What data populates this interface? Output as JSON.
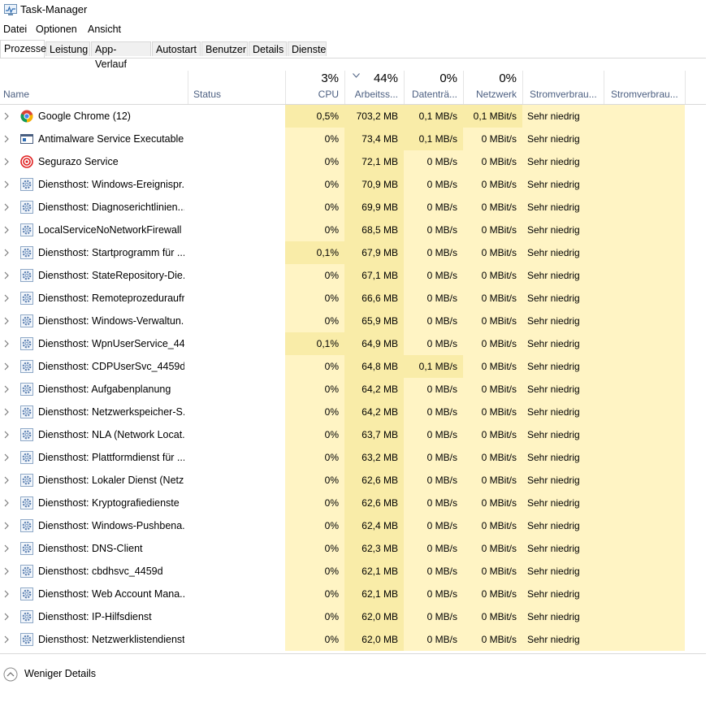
{
  "window": {
    "title": "Task-Manager"
  },
  "menu": [
    "Datei",
    "Optionen",
    "Ansicht"
  ],
  "tabs": [
    "Prozesse",
    "Leistung",
    "App-Verlauf",
    "Autostart",
    "Benutzer",
    "Details",
    "Dienste"
  ],
  "active_tab": "Prozesse",
  "columns": {
    "name": "Name",
    "status": "Status",
    "cpu": {
      "pct": "3%",
      "label": "CPU"
    },
    "mem": {
      "pct": "44%",
      "label": "Arbeitss..."
    },
    "disk": {
      "pct": "0%",
      "label": "Datenträ..."
    },
    "net": {
      "pct": "0%",
      "label": "Netzwerk"
    },
    "power": "Stromverbrau...",
    "power_trend": "Stromverbrau..."
  },
  "colors": {
    "heat_light": "#fff4c4",
    "heat_mid": "#f9eca8",
    "header_label": "#4d6082"
  },
  "processes": [
    {
      "name": "Google Chrome (12)",
      "icon": "chrome-icon",
      "cpu": "0,5%",
      "mem": "703,2 MB",
      "disk": "0,1 MB/s",
      "net": "0,1 MBit/s",
      "power": "Sehr niedrig",
      "cpu_hot": true,
      "disk_hot": true,
      "net_hot": true
    },
    {
      "name": "Antimalware Service Executable",
      "icon": "antimalware-icon",
      "cpu": "0%",
      "mem": "73,4 MB",
      "disk": "0,1 MB/s",
      "net": "0 MBit/s",
      "power": "Sehr niedrig",
      "disk_hot": true
    },
    {
      "name": "Segurazo Service",
      "icon": "segurazo-icon",
      "cpu": "0%",
      "mem": "72,1 MB",
      "disk": "0 MB/s",
      "net": "0 MBit/s",
      "power": "Sehr niedrig"
    },
    {
      "name": "Diensthost: Windows-Ereignispr...",
      "icon": "gear-icon",
      "cpu": "0%",
      "mem": "70,9 MB",
      "disk": "0 MB/s",
      "net": "0 MBit/s",
      "power": "Sehr niedrig"
    },
    {
      "name": "Diensthost: Diagnoserichtlinien...",
      "icon": "gear-icon",
      "cpu": "0%",
      "mem": "69,9 MB",
      "disk": "0 MB/s",
      "net": "0 MBit/s",
      "power": "Sehr niedrig"
    },
    {
      "name": "LocalServiceNoNetworkFirewall ...",
      "icon": "gear-icon",
      "cpu": "0%",
      "mem": "68,5 MB",
      "disk": "0 MB/s",
      "net": "0 MBit/s",
      "power": "Sehr niedrig"
    },
    {
      "name": "Diensthost: Startprogramm für ...",
      "icon": "gear-icon",
      "cpu": "0,1%",
      "mem": "67,9 MB",
      "disk": "0 MB/s",
      "net": "0 MBit/s",
      "power": "Sehr niedrig",
      "cpu_hot": true
    },
    {
      "name": "Diensthost: StateRepository-Die...",
      "icon": "gear-icon",
      "cpu": "0%",
      "mem": "67,1 MB",
      "disk": "0 MB/s",
      "net": "0 MBit/s",
      "power": "Sehr niedrig"
    },
    {
      "name": "Diensthost: Remoteprozeduraufr...",
      "icon": "gear-icon",
      "cpu": "0%",
      "mem": "66,6 MB",
      "disk": "0 MB/s",
      "net": "0 MBit/s",
      "power": "Sehr niedrig"
    },
    {
      "name": "Diensthost: Windows-Verwaltun...",
      "icon": "gear-icon",
      "cpu": "0%",
      "mem": "65,9 MB",
      "disk": "0 MB/s",
      "net": "0 MBit/s",
      "power": "Sehr niedrig"
    },
    {
      "name": "Diensthost: WpnUserService_44...",
      "icon": "gear-icon",
      "cpu": "0,1%",
      "mem": "64,9 MB",
      "disk": "0 MB/s",
      "net": "0 MBit/s",
      "power": "Sehr niedrig",
      "cpu_hot": true
    },
    {
      "name": "Diensthost: CDPUserSvc_4459d",
      "icon": "gear-icon",
      "cpu": "0%",
      "mem": "64,8 MB",
      "disk": "0,1 MB/s",
      "net": "0 MBit/s",
      "power": "Sehr niedrig",
      "disk_hot": true
    },
    {
      "name": "Diensthost: Aufgabenplanung",
      "icon": "gear-icon",
      "cpu": "0%",
      "mem": "64,2 MB",
      "disk": "0 MB/s",
      "net": "0 MBit/s",
      "power": "Sehr niedrig"
    },
    {
      "name": "Diensthost: Netzwerkspeicher-S...",
      "icon": "gear-icon",
      "cpu": "0%",
      "mem": "64,2 MB",
      "disk": "0 MB/s",
      "net": "0 MBit/s",
      "power": "Sehr niedrig"
    },
    {
      "name": "Diensthost: NLA (Network Locat...",
      "icon": "gear-icon",
      "cpu": "0%",
      "mem": "63,7 MB",
      "disk": "0 MB/s",
      "net": "0 MBit/s",
      "power": "Sehr niedrig"
    },
    {
      "name": "Diensthost: Plattformdienst für ...",
      "icon": "gear-icon",
      "cpu": "0%",
      "mem": "63,2 MB",
      "disk": "0 MB/s",
      "net": "0 MBit/s",
      "power": "Sehr niedrig"
    },
    {
      "name": "Diensthost: Lokaler Dienst (Netz...",
      "icon": "gear-icon",
      "cpu": "0%",
      "mem": "62,6 MB",
      "disk": "0 MB/s",
      "net": "0 MBit/s",
      "power": "Sehr niedrig"
    },
    {
      "name": "Diensthost: Kryptografiedienste",
      "icon": "gear-icon",
      "cpu": "0%",
      "mem": "62,6 MB",
      "disk": "0 MB/s",
      "net": "0 MBit/s",
      "power": "Sehr niedrig"
    },
    {
      "name": "Diensthost: Windows-Pushbena...",
      "icon": "gear-icon",
      "cpu": "0%",
      "mem": "62,4 MB",
      "disk": "0 MB/s",
      "net": "0 MBit/s",
      "power": "Sehr niedrig"
    },
    {
      "name": "Diensthost: DNS-Client",
      "icon": "gear-icon",
      "cpu": "0%",
      "mem": "62,3 MB",
      "disk": "0 MB/s",
      "net": "0 MBit/s",
      "power": "Sehr niedrig"
    },
    {
      "name": "Diensthost: cbdhsvc_4459d",
      "icon": "gear-icon",
      "cpu": "0%",
      "mem": "62,1 MB",
      "disk": "0 MB/s",
      "net": "0 MBit/s",
      "power": "Sehr niedrig"
    },
    {
      "name": "Diensthost: Web Account Mana...",
      "icon": "gear-icon",
      "cpu": "0%",
      "mem": "62,1 MB",
      "disk": "0 MB/s",
      "net": "0 MBit/s",
      "power": "Sehr niedrig"
    },
    {
      "name": "Diensthost: IP-Hilfsdienst",
      "icon": "gear-icon",
      "cpu": "0%",
      "mem": "62,0 MB",
      "disk": "0 MB/s",
      "net": "0 MBit/s",
      "power": "Sehr niedrig"
    },
    {
      "name": "Diensthost: Netzwerklistendienst",
      "icon": "gear-icon",
      "cpu": "0%",
      "mem": "62,0 MB",
      "disk": "0 MB/s",
      "net": "0 MBit/s",
      "power": "Sehr niedrig"
    }
  ],
  "footer": {
    "less_details": "Weniger Details"
  }
}
